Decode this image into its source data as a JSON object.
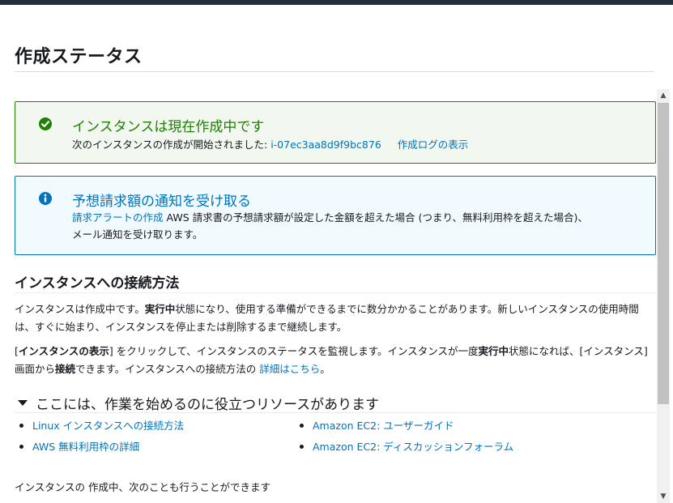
{
  "page": {
    "title": "作成ステータス"
  },
  "alerts": {
    "success": {
      "title": "インスタンスは現在作成中です",
      "body_prefix": "次のインスタンスの作成が開始されました: ",
      "instance_id": "i-07ec3aa8d9f9bc876",
      "log_link": "作成ログの表示",
      "icon": "check-circle-icon",
      "color": "#1d8102"
    },
    "info": {
      "title": "予想請求額の通知を受け取る",
      "link": "請求アラートの作成",
      "body_line1": " AWS 請求書の予想請求額が設定した金額を超えた場合 (つまり、無料利用枠を超えた場合)、",
      "body_line2": "メール通知を受け取ります。",
      "icon": "info-circle-icon",
      "color": "#0073bb"
    }
  },
  "connect": {
    "heading": "インスタンスへの接続方法",
    "p1_a": "インスタンスは作成中です。",
    "p1_bold": "実行中",
    "p1_b": "状態になり、使用する準備ができるまでに数分かかることがあります。新しいインスタンスの使用時間は、すぐに始まり、インスタンスを停止または削除するまで継続します。",
    "p2_a": "[",
    "p2_bold1": "インスタンスの表示",
    "p2_b": "] をクリックして、インスタンスのステータスを監視します。インスタンスが一度",
    "p2_bold2": "実行中",
    "p2_c": "状態になれば、[インスタンス] 画面から",
    "p2_bold3": "接続",
    "p2_d": "できます。インスタンスへの接続方法の ",
    "p2_link": "詳細はこちら",
    "p2_e": "。"
  },
  "resources": {
    "heading": "ここには、作業を始めるのに役立つリソースがあります",
    "items": [
      "Linux インスタンスへの接続方法",
      "Amazon EC2: ユーザーガイド",
      "AWS 無料利用枠の詳細",
      "Amazon EC2: ディスカッションフォーラム"
    ]
  },
  "footer": {
    "text": "インスタンスの 作成中、次のことも行うことができます"
  },
  "colors": {
    "topbar": "#232f3e",
    "link": "#0073bb"
  }
}
